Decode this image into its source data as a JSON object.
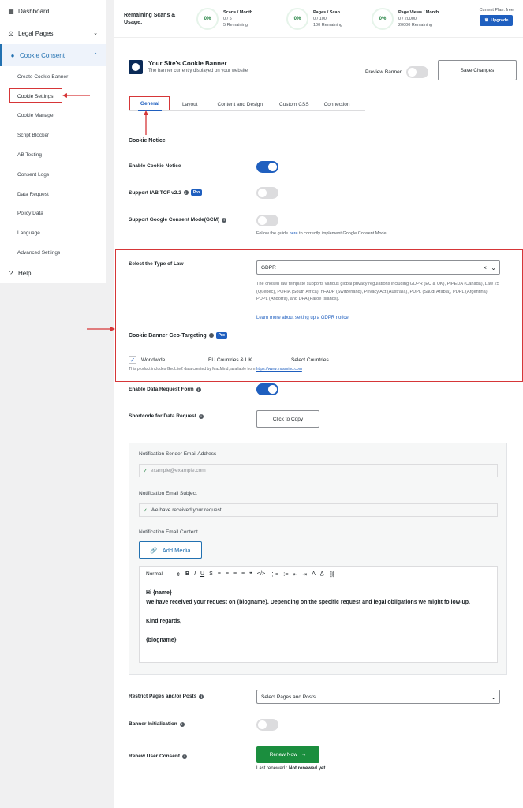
{
  "sidebar": {
    "dashboard": "Dashboard",
    "legal_pages": "Legal Pages",
    "cookie_consent": "Cookie Consent",
    "items": [
      "Create Cookie Banner",
      "Cookie Settings",
      "Cookie Manager",
      "Script Blocker",
      "AB Testing",
      "Consent Logs",
      "Data Request",
      "Policy Data",
      "Language",
      "Advanced Settings"
    ],
    "help": "Help"
  },
  "usage": {
    "title": "Remaining Scans & Usage:",
    "stats": [
      {
        "pct": "0%",
        "label": "Scans / Month",
        "value": "0 / 5",
        "remaining": "5 Remaining"
      },
      {
        "pct": "0%",
        "label": "Pages / Scan",
        "value": "0 / 100",
        "remaining": "100 Remaining"
      },
      {
        "pct": "0%",
        "label": "Page Views / Month",
        "value": "0 / 20000",
        "remaining": "20000 Remaining"
      }
    ],
    "plan": "Current Plan: free",
    "upgrade": "Upgrade"
  },
  "banner": {
    "title": "Your Site's Cookie Banner",
    "subtitle": "The banner currently displayed on your website",
    "preview": "Preview Banner",
    "save": "Save Changes"
  },
  "tabs": [
    "General",
    "Layout",
    "Content and Design",
    "Custom CSS",
    "Connection"
  ],
  "settings": {
    "section": "Cookie Notice",
    "enable_notice": "Enable Cookie Notice",
    "iab": "Support IAB TCF v2.2",
    "pro": "Pro",
    "gcm": "Support Google Consent Mode(GCM)",
    "gcm_help_pre": "Follow the guide",
    "gcm_help_link": "here",
    "gcm_help_post": "to correctly implement Google Consent Mode",
    "law_label": "Select the Type of Law",
    "law_value": "GDPR",
    "law_desc": "The chosen law template supports various global privacy regulations including GDPR (EU & UK), PIPEDA (Canada), Law 25 (Quebec), POPIA (South Africa), nFADP (Switzerland), Privacy Act (Australia), PDPL (Saudi Arabia), PDPL (Argentina), PDPL (Andorra), and DPA (Faroe Islands).",
    "learn_more": "Learn more about setting up a GDPR notice",
    "geo_label": "Cookie Banner Geo-Targeting",
    "geo_options": [
      "Worldwide",
      "EU Countries & UK",
      "Select Countries"
    ],
    "maxmind_pre": "This product includes GeoLite2 data created by MaxMind, available from",
    "maxmind_link": "https://www.maxmind.com",
    "data_request_form": "Enable Data Request Form",
    "shortcode": "Shortcode for Data Request",
    "copy": "Click to Copy",
    "restrict": "Restrict Pages and/or Posts",
    "restrict_placeholder": "Select Pages and Posts",
    "banner_init": "Banner Initialization",
    "renew": "Renew User Consent",
    "renew_btn": "Renew Now",
    "last_renewed_label": "Last renewed :",
    "last_renewed_value": "Not renewed yet"
  },
  "notification": {
    "sender_label": "Notification Sender Email Address",
    "sender_placeholder": "example@example.com",
    "subject_label": "Notification Email Subject",
    "subject_value": "We have received your request",
    "content_label": "Notification Email Content",
    "add_media": "Add Media",
    "format": "Normal",
    "body_line1": "Hi {name}",
    "body_line2": "We have received your request on {blogname}. Depending on the specific request and legal obligations we might follow-up.",
    "body_line3": "Kind regards,",
    "body_line4": "{blogname}"
  }
}
